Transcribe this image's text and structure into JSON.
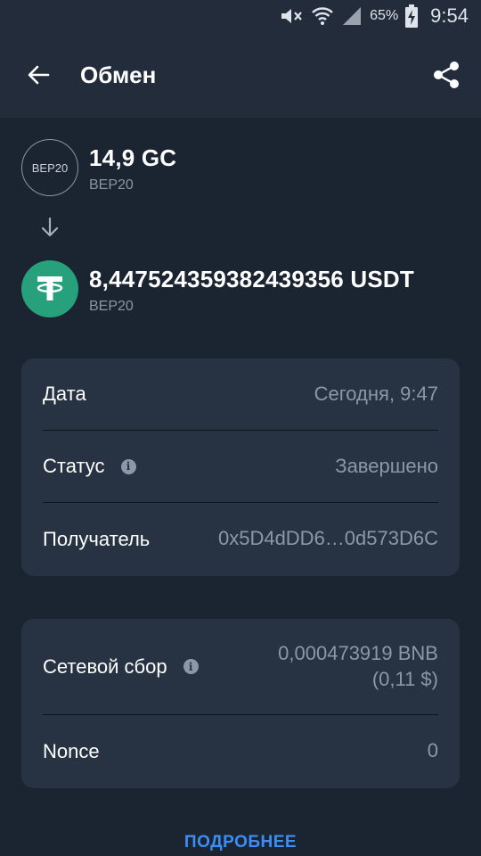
{
  "status_bar": {
    "battery": "65%",
    "time": "9:54",
    "icons": [
      "mute-icon",
      "wifi-icon",
      "signal-icon",
      "battery-charging-icon"
    ]
  },
  "header": {
    "title": "Обмен",
    "back_icon": "arrow-left-icon",
    "share_icon": "share-icon"
  },
  "from_asset": {
    "icon_text": "BEP20",
    "amount": "14,9 GC",
    "network": "BEP20"
  },
  "to_asset": {
    "icon": "tether-icon",
    "amount": "8,447524359382439356 USDT",
    "network": "BEP20"
  },
  "details": [
    {
      "label": "Дата",
      "value": "Сегодня, 9:47",
      "info": false
    },
    {
      "label": "Статус",
      "value": "Завершено",
      "info": true
    },
    {
      "label": "Получатель",
      "value": "0x5D4dDD6…0d573D6C",
      "info": false
    }
  ],
  "fees": {
    "network_fee_label": "Сетевой сбор",
    "network_fee_value": "0,000473919 BNB",
    "network_fee_fiat": "(0,11 $)",
    "nonce_label": "Nonce",
    "nonce_value": "0"
  },
  "more_link": "ПОДРОБНЕЕ",
  "colors": {
    "background": "#1b2431",
    "header": "#222c3a",
    "card": "#273242",
    "accent": "#3a8ef6",
    "tether": "#26a17b",
    "secondary_text": "#8d97a6"
  }
}
